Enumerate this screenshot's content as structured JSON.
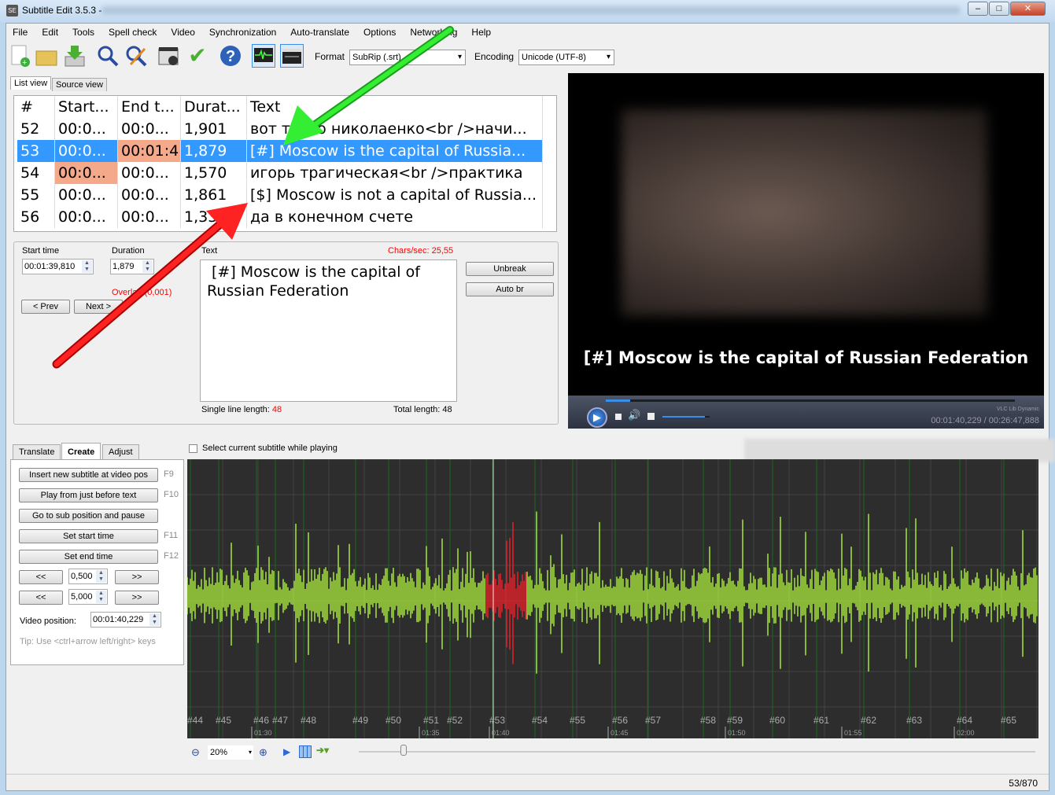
{
  "window": {
    "title": "Subtitle Edit 3.5.3 -",
    "app_icon": "SE",
    "minimize": "–",
    "maximize": "□",
    "close": "✕"
  },
  "menu": [
    "File",
    "Edit",
    "Tools",
    "Spell check",
    "Video",
    "Synchronization",
    "Auto-translate",
    "Options",
    "Networking",
    "Help"
  ],
  "toolbar": {
    "icons": [
      "new-file-icon",
      "open-folder-icon",
      "save-download-icon",
      "find-icon",
      "replace-icon",
      "visual-sync-icon",
      "spell-check-icon",
      "help-icon",
      "waveform-toggle-icon",
      "video-toggle-icon"
    ],
    "format_label": "Format",
    "format_value": "SubRip (.srt)",
    "encoding_label": "Encoding",
    "encoding_value": "Unicode (UTF-8)"
  },
  "view_tabs": [
    "List view",
    "Source view"
  ],
  "grid": {
    "headers": [
      "#",
      "Start...",
      "End t...",
      "Durat...",
      "Text"
    ],
    "rows": [
      {
        "num": "52",
        "start": "00:0...",
        "end": "00:0...",
        "dur": "1,901",
        "text": "вот такто николаенко<br />начи..."
      },
      {
        "num": "53",
        "start": "00:0...",
        "end": "00:01:4",
        "dur": "1,879",
        "text": " [#] Moscow is the capital of Russia...",
        "selected": true
      },
      {
        "num": "54",
        "start": "00:0...",
        "end": "00:0...",
        "dur": "1,570",
        "text": "игорь трагическая<br />практика"
      },
      {
        "num": "55",
        "start": "00:0...",
        "end": "00:0...",
        "dur": "1,861",
        "text": "[$] Moscow is not a capital of Russia..."
      },
      {
        "num": "56",
        "start": "00:0...",
        "end": "00:0...",
        "dur": "1,330",
        "text": "да в конечном счете"
      }
    ]
  },
  "edit": {
    "start_label": "Start time",
    "start_value": "00:01:39,810",
    "duration_label": "Duration",
    "duration_value": "1,879",
    "overlap": "Overlap (0,001)",
    "prev": "< Prev",
    "next": "Next >",
    "text_label": "Text",
    "chars_sec": "Chars/sec: 25,55",
    "text_line1": "[#] Moscow is the capital of",
    "text_line2": "Russian Federation",
    "single_line_label": "Single line length:",
    "single_line_value": "48",
    "total_label": "Total length: 48",
    "unbreak": "Unbreak",
    "auto_br": "Auto br"
  },
  "video": {
    "subtitle": "[#] Moscow is the capital of Russian Federation",
    "time": "00:01:40,229 / 00:26:47,888",
    "engine": "VLC Lib Dynamic",
    "progress": 0.06,
    "volume": 0.9
  },
  "tooltip_blurred": true,
  "lower_tabs": [
    "Translate",
    "Create",
    "Adjust"
  ],
  "create": {
    "buttons": [
      {
        "label": "Insert new subtitle at video pos",
        "key": "F9"
      },
      {
        "label": "Play from just before text",
        "key": "F10"
      },
      {
        "label": "Go to sub position and pause",
        "key": ""
      },
      {
        "label": "Set start time",
        "key": "F11"
      },
      {
        "label": "Set end time",
        "key": "F12"
      }
    ],
    "back": "<<",
    "fwd": ">>",
    "step1": "0,500",
    "step2": "5,000",
    "video_pos_label": "Video position:",
    "video_pos": "00:01:40,229",
    "tip": "Tip: Use <ctrl+arrow left/right> keys"
  },
  "waveform": {
    "select_current_label": "Select current subtitle while playing",
    "select_current_checked": false,
    "subtitle_labels": [
      "#44",
      "#45",
      "#46",
      "#47",
      "#48",
      "#49",
      "#50",
      "#51",
      "#52",
      "#53",
      "#54",
      "#55",
      "#56",
      "#57",
      "#58",
      "#59",
      "#60",
      "#61",
      "#62",
      "#63",
      "#64",
      "#65"
    ],
    "time_labels": [
      "01:30",
      "01:35",
      "01:40",
      "01:45",
      "01:50",
      "01:55",
      "02:00"
    ],
    "zoom": "20%",
    "wave_color": "#a8e63c",
    "selected_color": "#e8202a"
  },
  "status": {
    "position": "53/870"
  }
}
